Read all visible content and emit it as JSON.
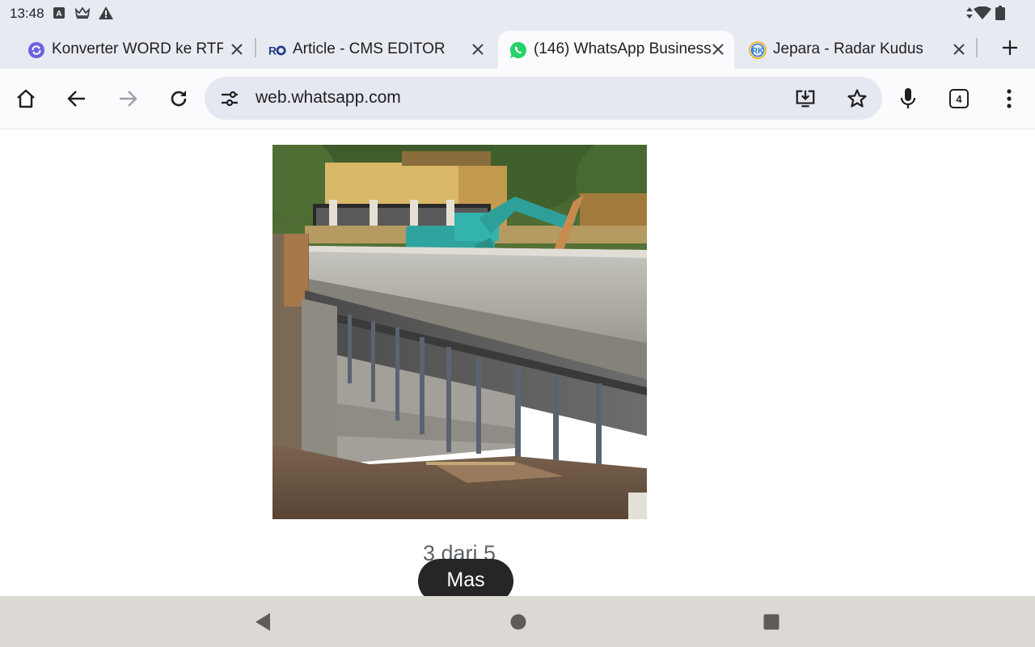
{
  "status_bar": {
    "time": "13:48",
    "left_icons": [
      "a-box-icon",
      "crown-icon",
      "warning-icon"
    ],
    "right_icons": [
      "data-arrows-icon",
      "wifi-icon",
      "battery-icon"
    ]
  },
  "tabs": [
    {
      "title": "Konverter WORD ke RTF - ",
      "favicon": "convert-icon",
      "active": false
    },
    {
      "title": "Article - CMS EDITOR",
      "favicon": "ro-logo-icon",
      "active": false
    },
    {
      "title": "(146) WhatsApp Business",
      "favicon": "whatsapp-icon",
      "active": true
    },
    {
      "title": "Jepara - Radar Kudus",
      "favicon": "rk-logo-icon",
      "active": false
    }
  ],
  "toolbar": {
    "url": "web.whatsapp.com",
    "tab_count": "4"
  },
  "viewer": {
    "image_alt": "Bridge construction with excavator",
    "counter": "3 dari 5",
    "chip_label": "Mas"
  },
  "colors": {
    "chrome_bg": "#e8eaf2",
    "active_tab": "#fbfbfe",
    "omnibox": "#e5e8f1",
    "whatsapp_green": "#25d366",
    "nav_bar": "#dcd9d4"
  }
}
